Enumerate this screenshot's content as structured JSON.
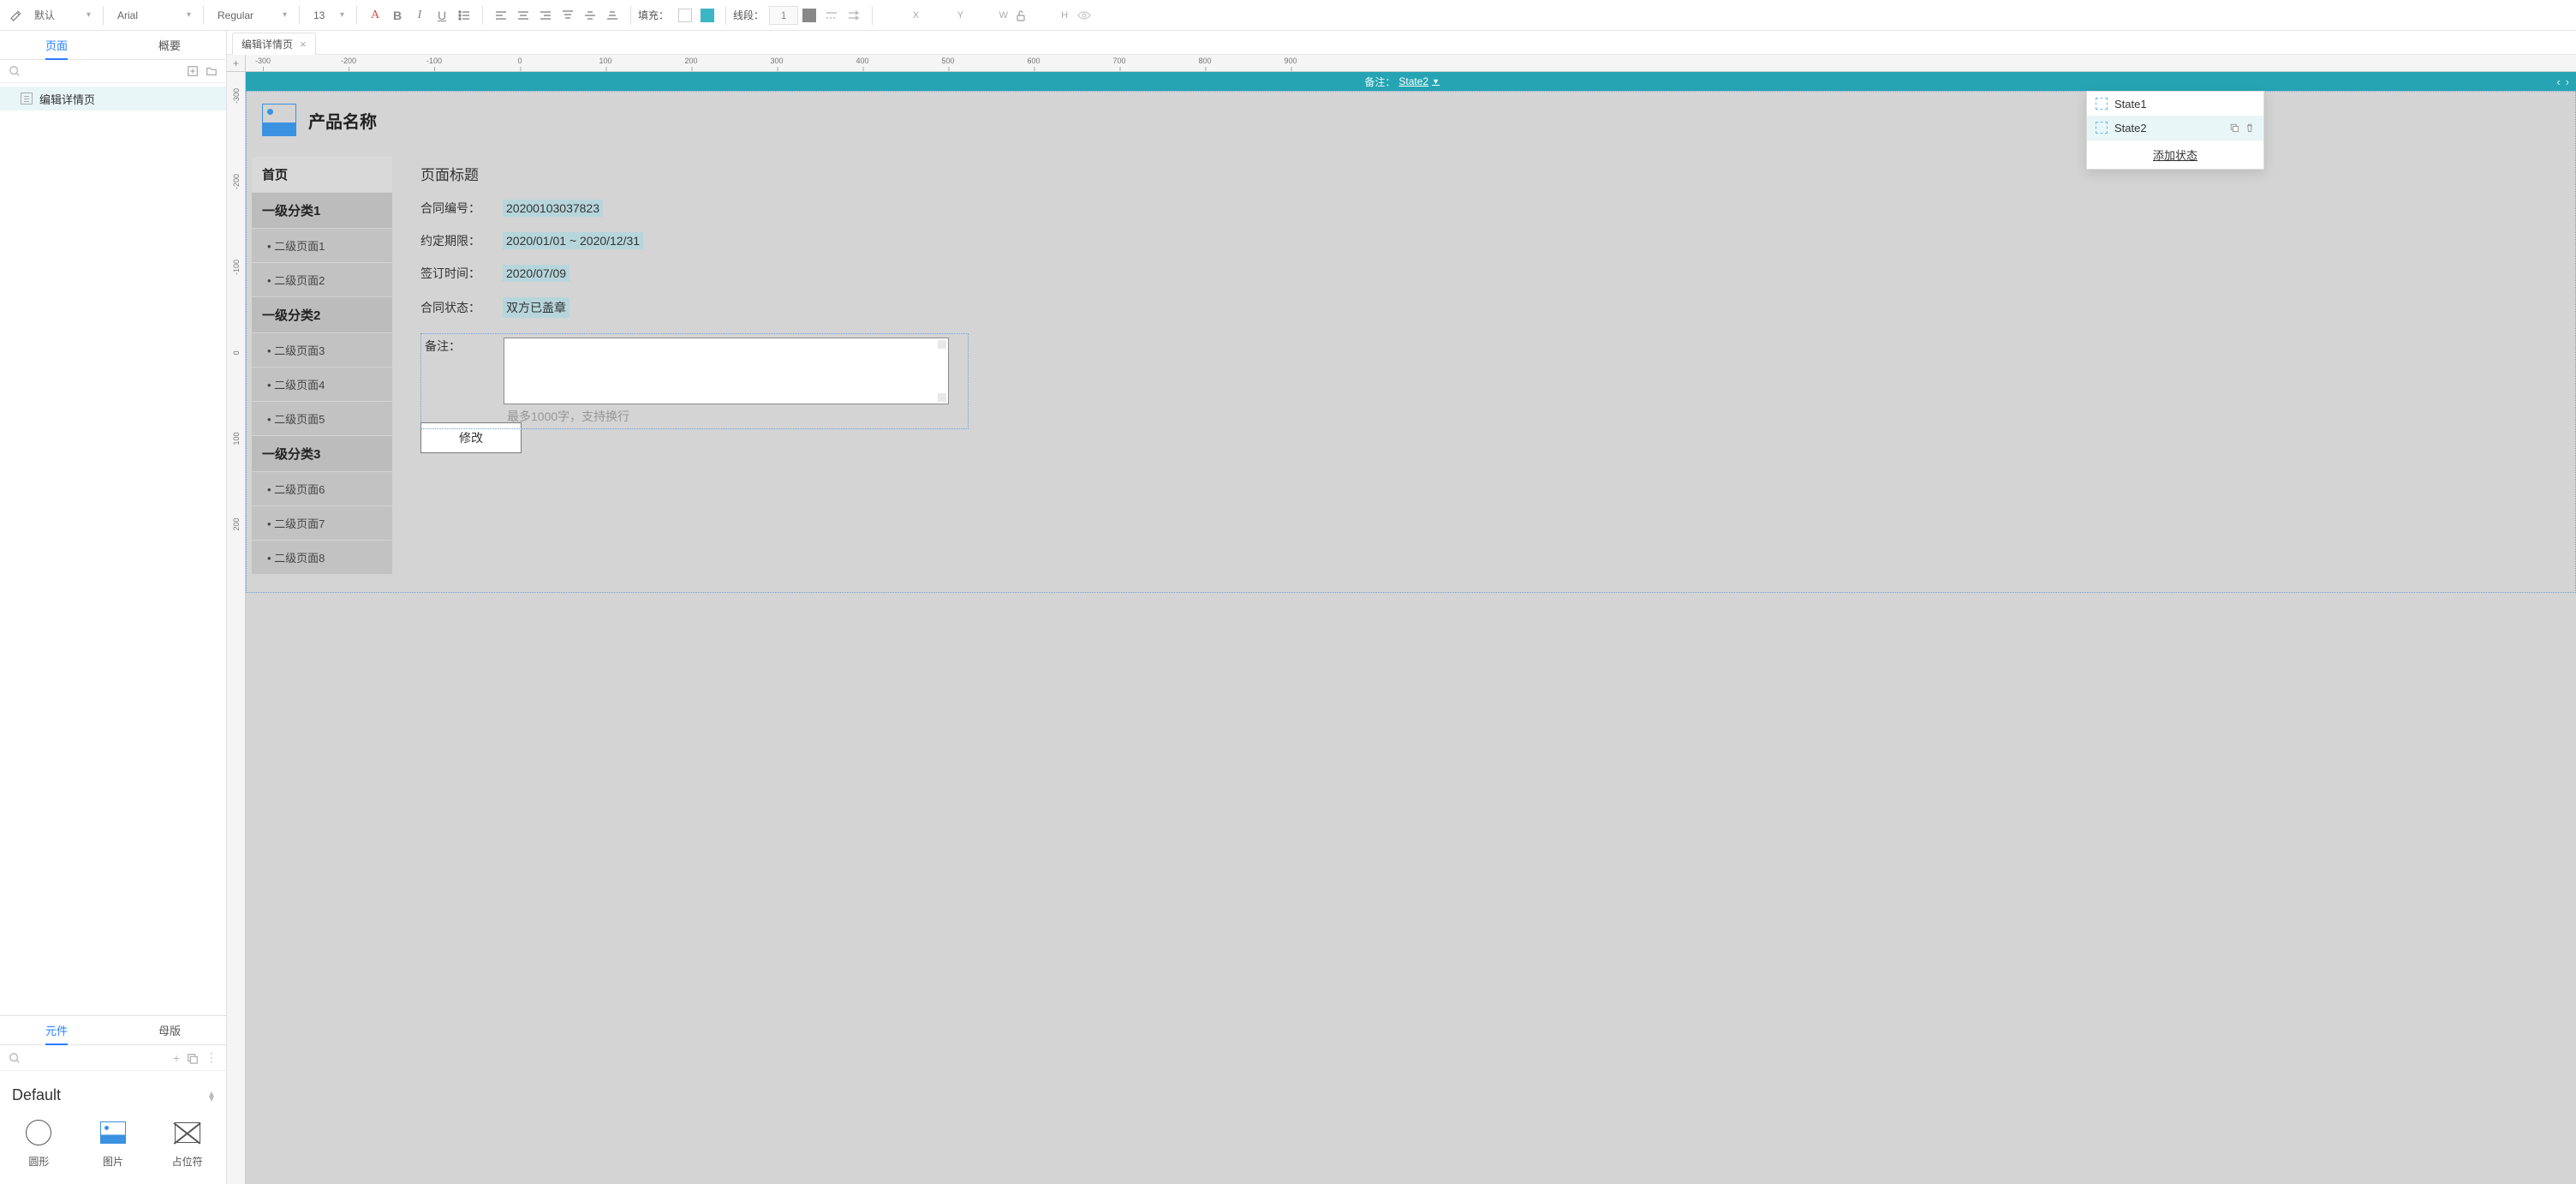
{
  "toolbar": {
    "style_default": "默认",
    "font": "Arial",
    "weight": "Regular",
    "size": "13",
    "fill_label": "填充：",
    "line_label": "线段：",
    "line_width": "1",
    "coords": {
      "x_label": "X",
      "y_label": "Y",
      "w_label": "W",
      "h_label": "H"
    }
  },
  "doc_tab": {
    "title": "编辑详情页"
  },
  "left": {
    "tabs": {
      "pages": "页面",
      "overview": "概要"
    },
    "tree": {
      "page0": "编辑详情页"
    },
    "bottom_tabs": {
      "widgets": "元件",
      "masters": "母版"
    },
    "lib_title": "Default",
    "widgets": {
      "ellipse": "圆形",
      "image": "图片",
      "placeholder": "占位符"
    }
  },
  "ruler_h": [
    "-300",
    "-200",
    "-100",
    "0",
    "100",
    "200",
    "300",
    "400",
    "500",
    "600",
    "700",
    "800",
    "900"
  ],
  "ruler_v": [
    "-300",
    "-200",
    "-100",
    "0",
    "100",
    "200"
  ],
  "dp_bar": {
    "label": "备注：",
    "selected": "State2"
  },
  "state_dd": {
    "items": [
      "State1",
      "State2"
    ],
    "add": "添加状态"
  },
  "proto": {
    "product_title": "产品名称",
    "side": {
      "home": "首页",
      "cats": [
        "一级分类1",
        "一级分类2",
        "一级分类3"
      ],
      "subs1": [
        "• 二级页面1",
        "• 二级页面2"
      ],
      "subs2": [
        "• 二级页面3",
        "• 二级页面4",
        "• 二级页面5"
      ],
      "subs3": [
        "• 二级页面6",
        "• 二级页面7",
        "• 二级页面8"
      ]
    },
    "main": {
      "title": "页面标题",
      "rows": {
        "contract_no_lbl": "合同编号：",
        "contract_no_val": "20200103037823",
        "period_lbl": "约定期限：",
        "period_val": "2020/01/01 ~ 2020/12/31",
        "sign_lbl": "签订时间：",
        "sign_val": "2020/07/09",
        "status_lbl": "合同状态：",
        "status_val": "双方已盖章",
        "note_lbl": "备注："
      },
      "hint": "最多1000字，支持换行",
      "edit_btn": "修改"
    }
  }
}
